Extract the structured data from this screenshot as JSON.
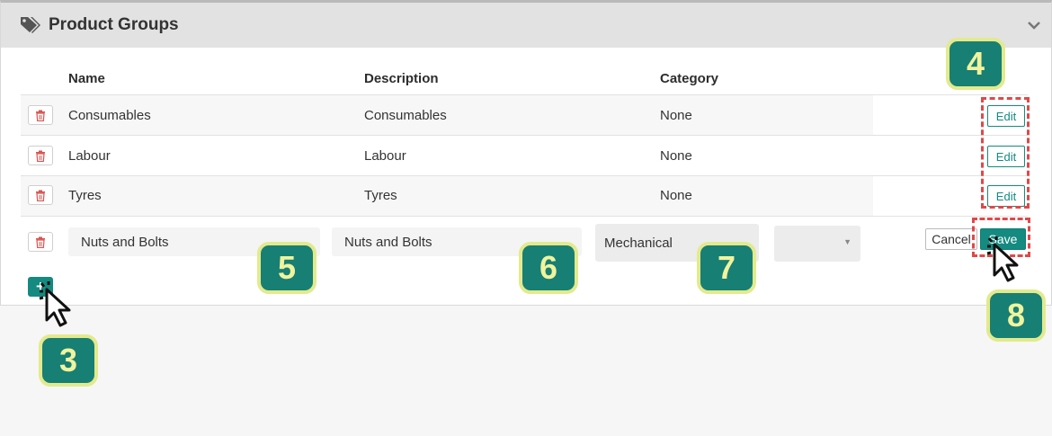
{
  "panel": {
    "title": "Product Groups",
    "icons": {
      "title": "tag-icon",
      "toggle": "chevron-down-icon"
    }
  },
  "table": {
    "headers": [
      "Name",
      "Description",
      "Category"
    ],
    "rows": [
      {
        "name": "Consumables",
        "description": "Consumables",
        "category": "None",
        "edit_label": "Edit"
      },
      {
        "name": "Labour",
        "description": "Labour",
        "category": "None",
        "edit_label": "Edit"
      },
      {
        "name": "Tyres",
        "description": "Tyres",
        "category": "None",
        "edit_label": "Edit"
      }
    ],
    "new_row": {
      "name_value": "Nuts and Bolts",
      "description_value": "Nuts and Bolts",
      "category_value": "Mechanical",
      "secondary_select_value": "",
      "cancel_label": "Cancel",
      "save_label": "Save"
    },
    "add_label": "+"
  },
  "annotations": {
    "badges": [
      "3",
      "4",
      "5",
      "6",
      "7",
      "8"
    ]
  },
  "colors": {
    "accent": "#148a80",
    "badge_bg": "#177f74",
    "badge_text": "#f1f39d",
    "highlight": "#e04848",
    "delete_icon": "#d9534f"
  }
}
